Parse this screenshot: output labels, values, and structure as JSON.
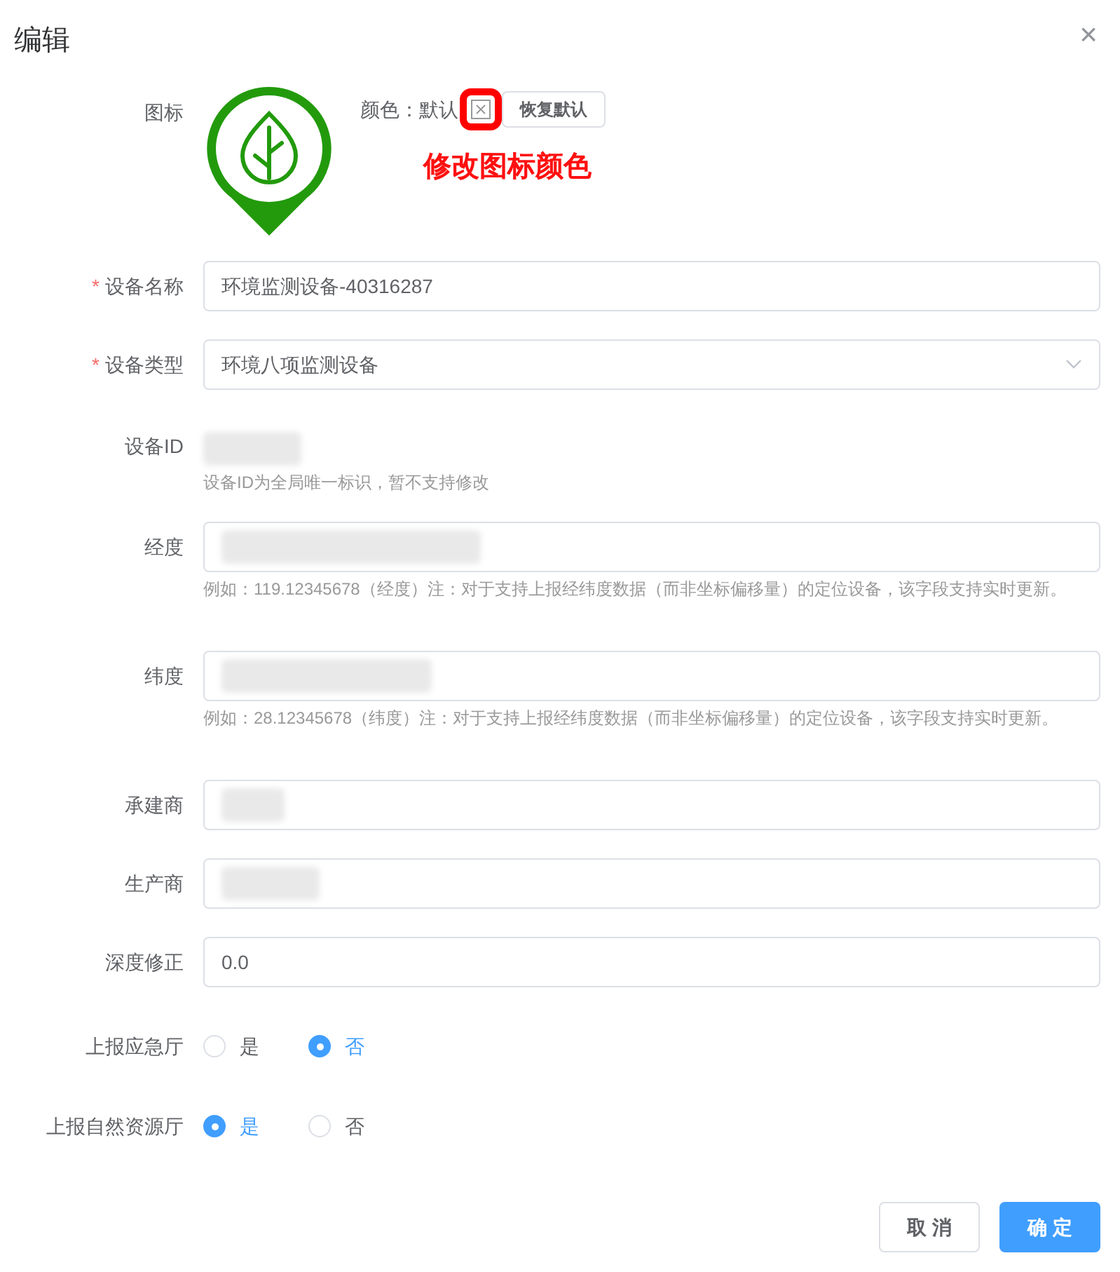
{
  "dialog": {
    "title": "编辑",
    "close": "×"
  },
  "icon_row": {
    "label": "图标",
    "color_label": "颜色：默认",
    "reset_button": "恢复默认",
    "annotation": "修改图标颜色"
  },
  "fields": [
    {
      "kind": "input",
      "label": "设备名称",
      "required_mark": "*",
      "value": "环境监测设备-40316287"
    },
    {
      "kind": "select",
      "label": "设备类型",
      "required_mark": "*",
      "value": "环境八项监测设备"
    },
    {
      "kind": "readonly",
      "label": "设备ID",
      "value_redacted": true,
      "hint": "设备ID为全局唯一标识，暂不支持修改"
    },
    {
      "kind": "input",
      "label": "经度",
      "value_redacted": true,
      "hint": "例如：119.12345678（经度）注：对于支持上报经纬度数据（而非坐标偏移量）的定位设备，该字段支持实时更新。"
    },
    {
      "kind": "input",
      "label": "纬度",
      "value_redacted": true,
      "hint": "例如：28.12345678（纬度）注：对于支持上报经纬度数据（而非坐标偏移量）的定位设备，该字段支持实时更新。"
    },
    {
      "kind": "input",
      "label": "承建商",
      "value_redacted": true
    },
    {
      "kind": "input",
      "label": "生产商",
      "value_redacted": true
    },
    {
      "kind": "input",
      "label": "深度修正",
      "value": "0.0"
    },
    {
      "kind": "radio",
      "label": "上报应急厅",
      "options": [
        {
          "label": "是",
          "selected": false
        },
        {
          "label": "否",
          "selected": true
        }
      ]
    },
    {
      "kind": "radio",
      "label": "上报自然资源厅",
      "options": [
        {
          "label": "是",
          "selected": true
        },
        {
          "label": "否",
          "selected": false
        }
      ]
    }
  ],
  "buttons": {
    "cancel": "取 消",
    "confirm": "确 定"
  }
}
